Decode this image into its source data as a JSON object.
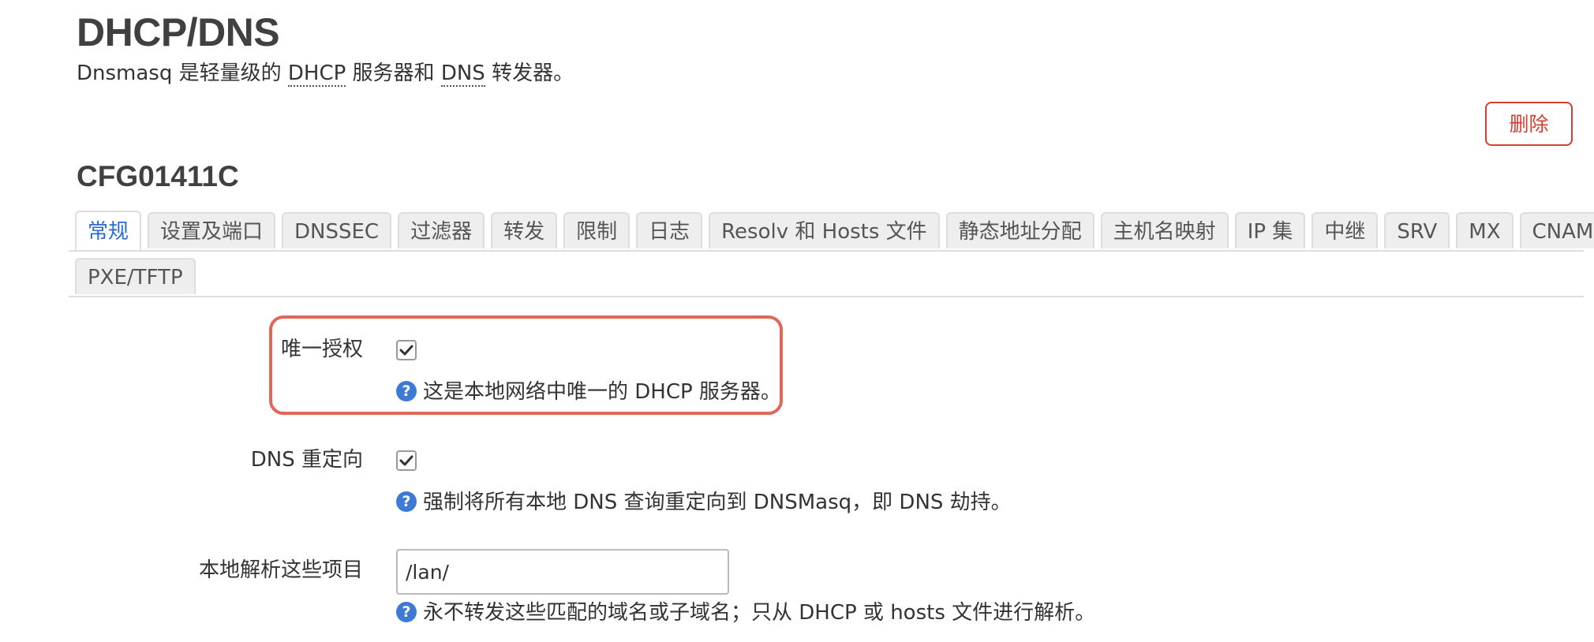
{
  "page": {
    "title": "DHCP/DNS",
    "description": {
      "prefix": "Dnsmasq 是轻量级的 ",
      "abbr1": "DHCP",
      "middle": " 服务器和 ",
      "abbr2": "DNS",
      "suffix": " 转发器。"
    },
    "delete_label": "删除"
  },
  "section": {
    "title": "CFG01411C"
  },
  "tabs": [
    {
      "label": "常规",
      "active": true
    },
    {
      "label": "设置及端口",
      "active": false
    },
    {
      "label": "DNSSEC",
      "active": false
    },
    {
      "label": "过滤器",
      "active": false
    },
    {
      "label": "转发",
      "active": false
    },
    {
      "label": "限制",
      "active": false
    },
    {
      "label": "日志",
      "active": false
    },
    {
      "label": "Resolv 和 Hosts 文件",
      "active": false
    },
    {
      "label": "静态地址分配",
      "active": false
    },
    {
      "label": "主机名映射",
      "active": false
    },
    {
      "label": "IP 集",
      "active": false
    },
    {
      "label": "中继",
      "active": false
    },
    {
      "label": "SRV",
      "active": false
    },
    {
      "label": "MX",
      "active": false
    },
    {
      "label": "CNAME",
      "active": false
    },
    {
      "label": "PXE/TFTP",
      "active": false
    }
  ],
  "settings": {
    "authoritative": {
      "label": "唯一授权",
      "checked": true,
      "help": "这是本地网络中唯一的 DHCP 服务器。"
    },
    "dns_redirect": {
      "label": "DNS 重定向",
      "checked": true,
      "help": "强制将所有本地 DNS 查询重定向到 DNSMasq，即 DNS 劫持。"
    },
    "local_domain": {
      "label": "本地解析这些项目",
      "value": "/lan/",
      "help": "永不转发这些匹配的域名或子域名；只从 DHCP 或 hosts 文件进行解析。"
    }
  },
  "icons": {
    "help": "?",
    "checkmark": "checkmark-icon"
  },
  "colors": {
    "accent": "#2a6cd4",
    "danger": "#d23f31",
    "highlight": "#e0685a",
    "help_icon": "#3d7ad6"
  }
}
